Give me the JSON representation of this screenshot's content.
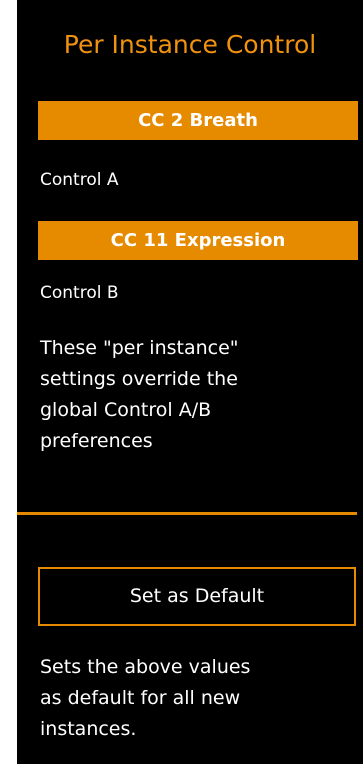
{
  "panel": {
    "title": "Per Instance Control",
    "control_a": {
      "value": "CC 2 Breath",
      "label": "Control A"
    },
    "control_b": {
      "value": "CC 11 Expression",
      "label": "Control B"
    },
    "description_lines": [
      "These \"per instance\"",
      "settings override the",
      "global Control A/B",
      "preferences"
    ],
    "default_button_label": "Set as Default",
    "default_description_lines": [
      "Sets the above values",
      "as default for all new",
      "instances."
    ]
  },
  "colors": {
    "background": "#000000",
    "accent": "#e68a00",
    "title": "#f0920f",
    "text": "#ffffff"
  }
}
